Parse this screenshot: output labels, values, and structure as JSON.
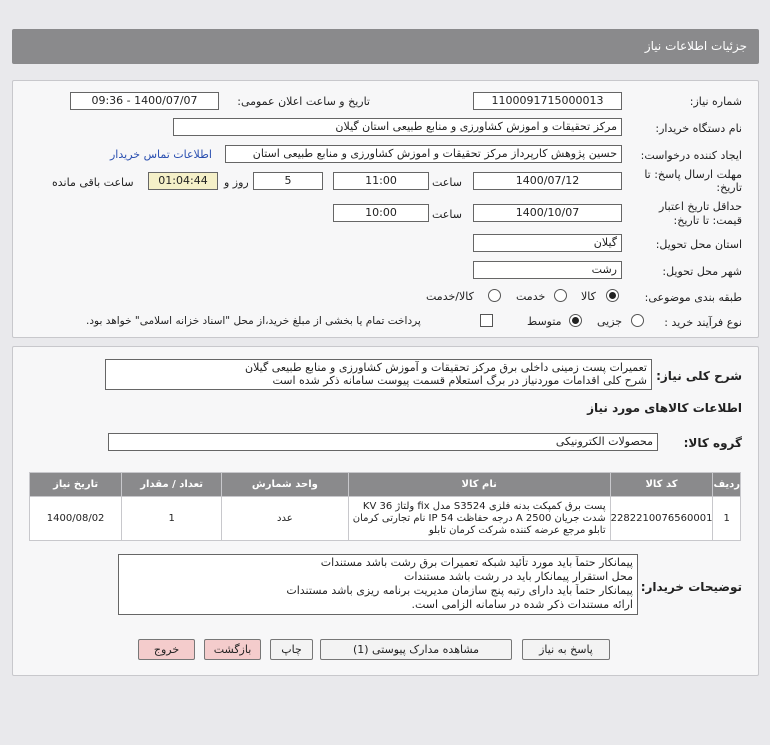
{
  "header": {
    "title": "جزئیات اطلاعات نیاز"
  },
  "form": {
    "need_number": {
      "label": "شماره نیاز:",
      "value": "1100091715000013"
    },
    "announce_datetime": {
      "label": "تاریخ و ساعت اعلان عمومی:",
      "value": "1400/07/07 - 09:36"
    },
    "buyer_org": {
      "label": "نام دستگاه خریدار:",
      "value": "مرکز تحقیقات و اموزش کشاورزی و منابع طبیعی استان گیلان"
    },
    "requester": {
      "label": "ایجاد کننده درخواست:",
      "value": "حسین پژوهش کارپرداز مرکز تحقیقات و اموزش کشاورزی و منابع طبیعی استان",
      "link": "اطلاعات تماس خریدار"
    },
    "deadline": {
      "label_line1": "مهلت ارسال پاسخ: تا",
      "label_line2": "تاریخ:",
      "date": "1400/07/12",
      "time_label": "ساعت",
      "time": "11:00",
      "days": "5",
      "days_label": "روز و",
      "remaining": "01:04:44",
      "remaining_label": "ساعت باقی مانده"
    },
    "validity": {
      "label_line1": "حداقل تاریخ اعتبار",
      "label_line2": "قیمت: تا تاریخ:",
      "date": "1400/10/07",
      "time_label": "ساعت",
      "time": "10:00"
    },
    "delivery_province": {
      "label": "استان محل تحویل:",
      "value": "گیلان"
    },
    "delivery_city": {
      "label": "شهر محل تحویل:",
      "value": "رشت"
    },
    "category": {
      "label": "طبقه بندی موضوعی:",
      "options": [
        "کالا",
        "خدمت",
        "کالا/خدمت"
      ],
      "selected": "کالا"
    },
    "process_type": {
      "label": "نوع فرآیند خرید :",
      "options": [
        "جزیی",
        "متوسط"
      ],
      "selected": "متوسط",
      "note": "پرداخت تمام یا بخشی از مبلغ خرید،از محل \"اسناد خزانه اسلامی\" خواهد بود."
    }
  },
  "description": {
    "label": "شرح کلی نیاز:",
    "lines": [
      "تعمیرات پست زمینی داخلی برق مرکز تحقیقات و آموزش کشاورزی و منابع طبیعی گیلان",
      "شرح کلی اقدامات موردنیاز در برگ استعلام قسمت پیوست سامانه ذکر شده است"
    ]
  },
  "goods_section_title": "اطلاعات کالاهای مورد نیاز",
  "goods_group": {
    "label": "گروه کالا:",
    "value": "محصولات الکترونیکی"
  },
  "table": {
    "headers": [
      "ردیف",
      "کد کالا",
      "نام کالا",
      "واحد شمارش",
      "تعداد / مقدار",
      "تاریخ نیاز"
    ],
    "rows": [
      {
        "row": "1",
        "code": "2282210076560001",
        "name_lines": [
          "پست برق کمپکت بدنه فلزی S3524 مدل fix ولتاژ 36 KV",
          "شدت جریان 2500 A درجه حفاظت IP 54 نام تجارتی کرمان",
          "تابلو مرجع عرضه کننده شرکت کرمان تابلو"
        ],
        "unit": "عدد",
        "qty": "1",
        "date": "1400/08/02"
      }
    ]
  },
  "buyer_notes": {
    "label": "توضیحات خریدار:",
    "lines": [
      "پیمانکار حتماً باید مورد تأئید شبکه تعمیرات برق رشت باشد مستندات",
      "محل استقرار پیمانکار باید در رشت باشد مستندات",
      "پیمانکار حتماً باید دارای رتبه پنج سازمان مدیریت برنامه ریزی باشد مستندات",
      "ارائه مستندات ذکر شده در سامانه الزامی است."
    ]
  },
  "buttons": {
    "reply": "پاسخ به نیاز",
    "attachments": "مشاهده مدارک پیوستی (1)",
    "print": "چاپ",
    "back": "بازگشت",
    "exit": "خروج"
  }
}
